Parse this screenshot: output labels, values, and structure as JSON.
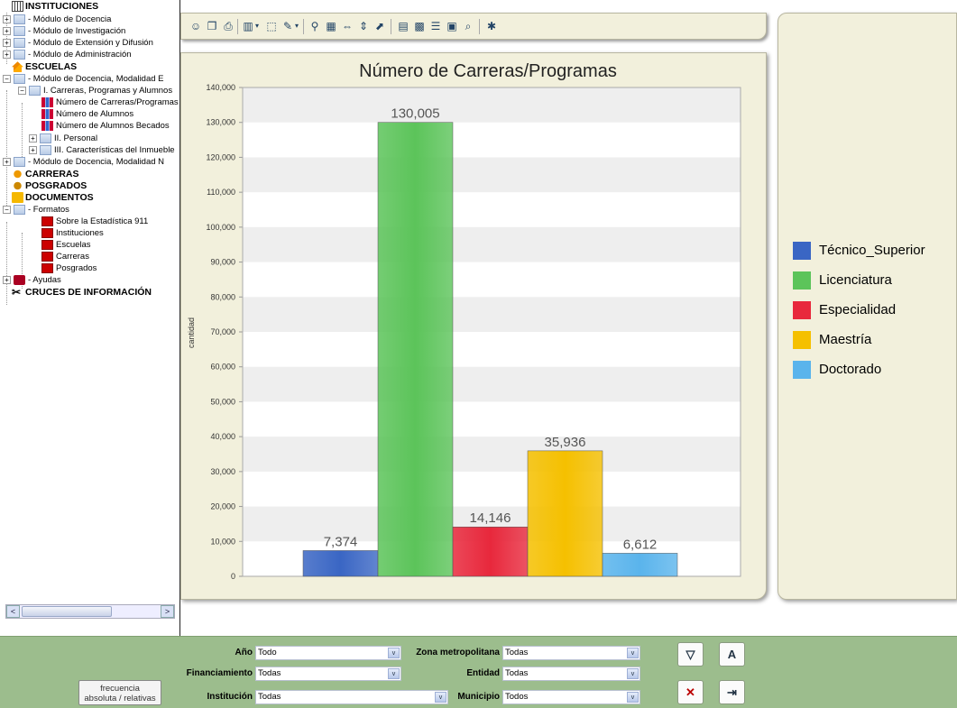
{
  "tree": {
    "instituciones": "INSTITUCIONES",
    "inst_items": [
      "- Módulo de Docencia",
      "- Módulo de Investigación",
      "- Módulo de Extensión y Difusión",
      "- Módulo de Administración"
    ],
    "escuelas": "ESCUELAS",
    "esc_mod1": "- Módulo de Docencia, Modalidad E",
    "esc_carreras": "I. Carreras, Programas y Alumnos",
    "esc_reports": [
      "Número de Carreras/Programas",
      "Número de Alumnos",
      "Número de Alumnos Becados"
    ],
    "esc_personal": "II. Personal",
    "esc_inmueble": "III. Características del Inmueble",
    "esc_mod2": "- Módulo de Docencia, Modalidad N",
    "carreras": "CARRERAS",
    "posgrados": "POSGRADOS",
    "documentos": "DOCUMENTOS",
    "formatos": "- Formatos",
    "pdfs": [
      "Sobre la Estadística 911",
      "Instituciones",
      "Escuelas",
      "Carreras",
      "Posgrados"
    ],
    "ayudas": "- Ayudas",
    "cruces": "CRUCES DE INFORMACIÓN",
    "scroll_left": "<",
    "scroll_right": ">"
  },
  "toolbar_icons": [
    "people-icon",
    "copy-icon",
    "print-icon",
    "chart-type-icon",
    "dropdown-icon",
    "select-icon",
    "draw-icon",
    "dropdown-icon",
    "zoom-icon",
    "grid-icon",
    "move-horizontal-icon",
    "move-vertical-icon",
    "export-icon",
    "chart-edit-icon",
    "data-labels-icon",
    "table-icon",
    "legend-icon",
    "preview-icon",
    "wizard-icon"
  ],
  "chart_data": {
    "type": "bar",
    "title": "Número de Carreras/Programas",
    "ylabel": "cantidad",
    "xlabel": "",
    "ylim": [
      0,
      140000
    ],
    "yticks": [
      0,
      10000,
      20000,
      30000,
      40000,
      50000,
      60000,
      70000,
      80000,
      90000,
      100000,
      110000,
      120000,
      130000,
      140000
    ],
    "ytick_labels": [
      "0",
      "10,000",
      "20,000",
      "30,000",
      "40,000",
      "50,000",
      "60,000",
      "70,000",
      "80,000",
      "90,000",
      "100,000",
      "110,000",
      "120,000",
      "130,000",
      "140,000"
    ],
    "series": [
      {
        "name": "Técnico_Superior",
        "value": 7374,
        "label": "7,374",
        "color": "#3a66c4"
      },
      {
        "name": "Licenciatura",
        "value": 130005,
        "label": "130,005",
        "color": "#5cc45a"
      },
      {
        "name": "Especialidad",
        "value": 14146,
        "label": "14,146",
        "color": "#e8283c"
      },
      {
        "name": "Maestría",
        "value": 35936,
        "label": "35,936",
        "color": "#f5c000"
      },
      {
        "name": "Doctorado",
        "value": 6612,
        "label": "6,612",
        "color": "#5ab4ec"
      }
    ],
    "grid": true,
    "legend_position": "right"
  },
  "filters": {
    "anio_label": "Año",
    "anio_value": "Todo",
    "financ_label": "Financiamiento",
    "financ_value": "Todas",
    "inst_label": "Institución",
    "inst_value": "Todas",
    "zona_label": "Zona metropolitana",
    "zona_value": "Todas",
    "entidad_label": "Entidad",
    "entidad_value": "Todas",
    "muni_label": "Municipio",
    "muni_value": "Todos",
    "dropdown_glyph": "v",
    "btn_filter": "▽",
    "btn_font": "A",
    "btn_clear": "✕",
    "btn_exit": "⇥",
    "freq_line1": "frecuencia",
    "freq_line2": "absoluta / relativas"
  }
}
